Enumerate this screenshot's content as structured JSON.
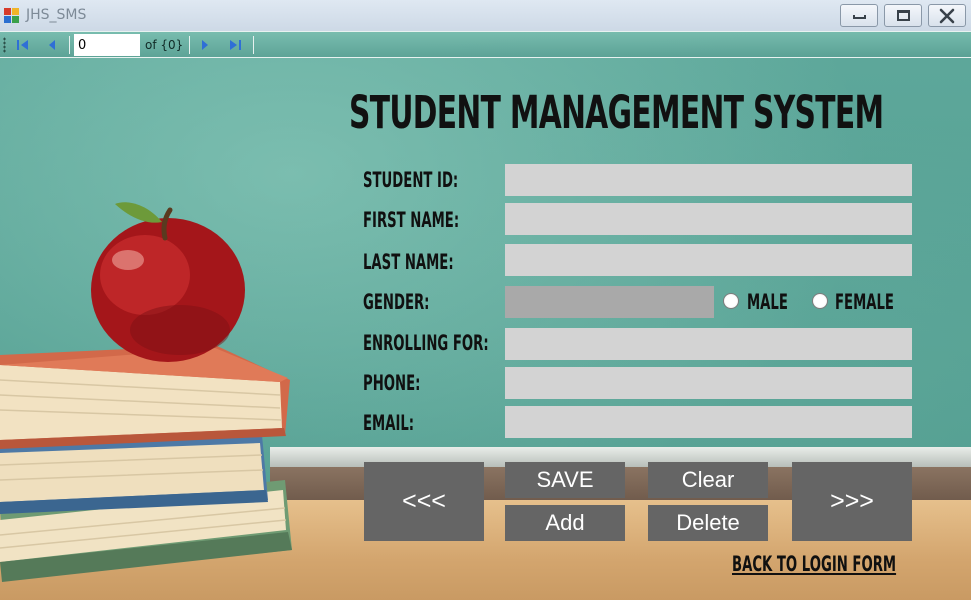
{
  "window": {
    "title": "JHS_SMS"
  },
  "navigator": {
    "position": "0",
    "count_label": "of {0}"
  },
  "page": {
    "title": "STUDENT MANAGEMENT SYSTEM"
  },
  "form": {
    "student_id_label": "STUDENT ID:",
    "first_name_label": "FIRST NAME:",
    "last_name_label": "LAST NAME:",
    "gender_label": "GENDER:",
    "enrolling_label": "ENROLLING FOR:",
    "phone_label": "PHONE:",
    "email_label": "EMAIL:",
    "student_id": "",
    "first_name": "",
    "last_name": "",
    "enrolling_for": "",
    "phone": "",
    "email": "",
    "gender_male": "MALE",
    "gender_female": "FEMALE"
  },
  "actions": {
    "prev": "<<<",
    "next": ">>>",
    "save": "SAVE",
    "add": "Add",
    "clear": "Clear",
    "delete": "Delete",
    "back": "BACK TO LOGIN FORM"
  },
  "colors": {
    "chalkboard": "#5ea89b",
    "button": "#656565",
    "field": "#d3d3d3",
    "gender_box": "#a9a9a9",
    "nav_icon": "#2f6fd6"
  },
  "icons": {
    "app": "app-icon",
    "nav_first": "move-first-icon",
    "nav_prev": "move-previous-icon",
    "nav_next": "move-next-icon",
    "nav_last": "move-last-icon"
  }
}
